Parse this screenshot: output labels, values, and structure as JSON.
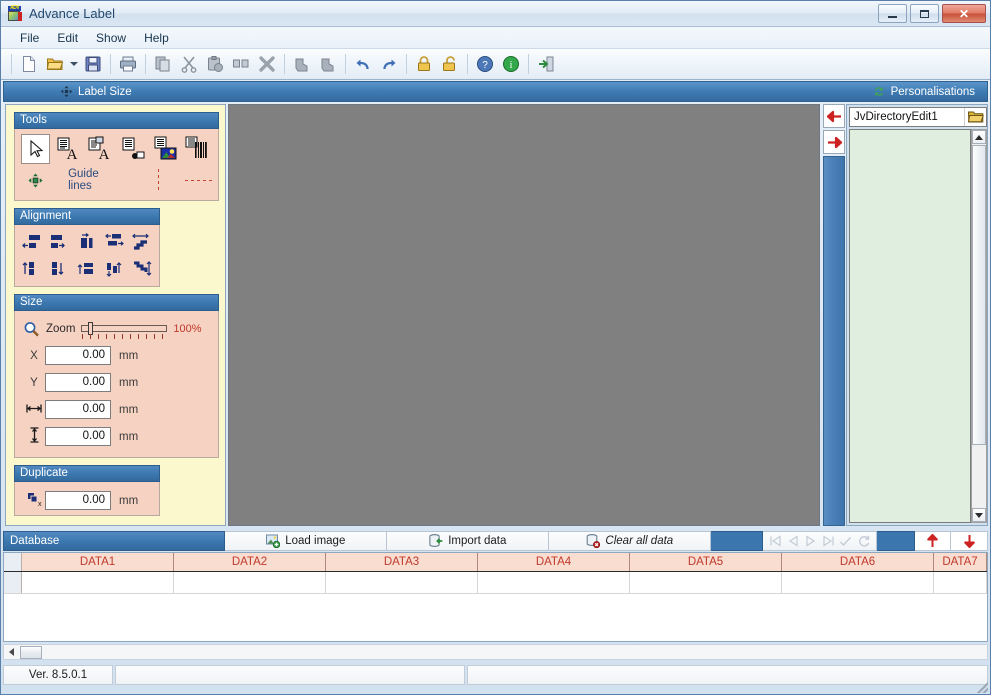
{
  "window": {
    "title": "Advance Label",
    "icon": "app-icon",
    "minimize_label": "–",
    "maximize_label": "□",
    "close_label": "✕"
  },
  "menubar": {
    "items": [
      {
        "label": "File",
        "name": "menu-file"
      },
      {
        "label": "Edit",
        "name": "menu-edit"
      },
      {
        "label": "Show",
        "name": "menu-show"
      },
      {
        "label": "Help",
        "name": "menu-help"
      }
    ]
  },
  "toolbar": {
    "buttons": [
      {
        "name": "new-document-button",
        "icon": "new-document-icon",
        "tooltip": "New"
      },
      {
        "name": "open-folder-button",
        "icon": "open-folder-icon",
        "tooltip": "Open"
      },
      {
        "name": "open-dropdown-button",
        "icon": "chevron-down-icon",
        "tooltip": "Recent"
      },
      {
        "name": "save-button",
        "icon": "save-disk-icon",
        "tooltip": "Save"
      },
      {
        "name": "print-button",
        "icon": "printer-icon",
        "tooltip": "Print"
      },
      {
        "name": "copy-button",
        "icon": "copy-icon",
        "tooltip": "Copy"
      },
      {
        "name": "cut-button",
        "icon": "scissors-icon",
        "tooltip": "Cut"
      },
      {
        "name": "paste-button",
        "icon": "paste-icon",
        "tooltip": "Paste"
      },
      {
        "name": "duplicate-button",
        "icon": "duplicate-icon",
        "tooltip": "Duplicate"
      },
      {
        "name": "delete-button",
        "icon": "delete-x-icon",
        "tooltip": "Delete"
      },
      {
        "name": "bring-front-button",
        "icon": "bring-front-icon",
        "tooltip": "Bring to front"
      },
      {
        "name": "send-back-button",
        "icon": "send-back-icon",
        "tooltip": "Send to back"
      },
      {
        "name": "undo-button",
        "icon": "undo-arrow-icon",
        "tooltip": "Undo"
      },
      {
        "name": "redo-button",
        "icon": "redo-arrow-icon",
        "tooltip": "Redo"
      },
      {
        "name": "lock-button",
        "icon": "lock-closed-icon",
        "tooltip": "Lock"
      },
      {
        "name": "unlock-button",
        "icon": "lock-open-icon",
        "tooltip": "Unlock"
      },
      {
        "name": "help-button",
        "icon": "help-question-icon",
        "tooltip": "Help"
      },
      {
        "name": "about-button",
        "icon": "info-icon",
        "tooltip": "About"
      },
      {
        "name": "exit-button",
        "icon": "exit-door-icon",
        "tooltip": "Exit"
      }
    ]
  },
  "header": {
    "label_size": "Label Size",
    "label_size_icon": "move-resize-icon",
    "personalisations": "Personalisations",
    "personalisations_icon": "refresh-arrows-icon"
  },
  "tools_panel": {
    "title": "Tools",
    "buttons": [
      {
        "name": "tool-select",
        "icon": "cursor-arrow-icon",
        "selected": true
      },
      {
        "name": "tool-text",
        "icon": "text-a-icon",
        "selected": false
      },
      {
        "name": "tool-rich-text",
        "icon": "rich-text-a-icon",
        "selected": false
      },
      {
        "name": "tool-shape",
        "icon": "shape-object-icon",
        "selected": false
      },
      {
        "name": "tool-image",
        "icon": "picture-image-icon",
        "selected": false
      },
      {
        "name": "tool-barcode",
        "icon": "barcode-icon",
        "selected": false
      }
    ],
    "guide_lines_icon": "move-cross-icon",
    "guide_lines_label": "Guide lines",
    "vertical_guide": "vertical-dashed-guide",
    "horizontal_guide": "horizontal-dashed-guide"
  },
  "alignment_panel": {
    "title": "Alignment",
    "buttons": [
      {
        "name": "align-left",
        "icon": "align-left-icon"
      },
      {
        "name": "align-right",
        "icon": "align-right-icon"
      },
      {
        "name": "align-center-horizontal",
        "icon": "align-center-h-icon"
      },
      {
        "name": "distribute-horizontal",
        "icon": "distribute-h-icon"
      },
      {
        "name": "equal-width",
        "icon": "equal-width-icon"
      },
      {
        "name": "align-top",
        "icon": "align-top-icon"
      },
      {
        "name": "align-bottom",
        "icon": "align-bottom-icon"
      },
      {
        "name": "align-center-vertical",
        "icon": "align-center-v-icon"
      },
      {
        "name": "distribute-vertical",
        "icon": "distribute-v-icon"
      },
      {
        "name": "equal-height",
        "icon": "equal-height-icon"
      }
    ]
  },
  "size_panel": {
    "title": "Size",
    "zoom_icon": "magnifier-icon",
    "zoom_label": "Zoom",
    "zoom_value": "100%",
    "fields": [
      {
        "name": "field-x",
        "label": "X",
        "icon": "",
        "value": "0.00",
        "unit": "mm"
      },
      {
        "name": "field-y",
        "label": "Y",
        "icon": "",
        "value": "0.00",
        "unit": "mm"
      },
      {
        "name": "field-width",
        "label": "",
        "icon": "width-arrows-icon",
        "value": "0.00",
        "unit": "mm"
      },
      {
        "name": "field-height",
        "label": "",
        "icon": "height-arrows-icon",
        "value": "0.00",
        "unit": "mm"
      }
    ]
  },
  "duplicate_panel": {
    "title": "Duplicate",
    "field": {
      "name": "field-duplicate-x",
      "icon": "duplicate-x-icon",
      "value": "0.00",
      "unit": "mm"
    }
  },
  "canvas": {
    "name": "label-design-canvas",
    "background": "#808080"
  },
  "splitter": {
    "left_arrow_icon": "arrow-left-red-icon",
    "right_arrow_icon": "arrow-right-red-icon"
  },
  "right_panel": {
    "directory_edit": {
      "name": "directory-edit-input",
      "value": "JvDirectoryEdit1",
      "browse_icon": "folder-open-icon"
    },
    "file_list": {
      "name": "file-list-box",
      "items": []
    },
    "scrollbar": {
      "up_icon": "scroll-up-icon",
      "down_icon": "scroll-down-icon"
    }
  },
  "database_bar": {
    "title": "Database",
    "buttons": [
      {
        "name": "load-image-button",
        "label": "Load image",
        "icon": "image-plus-icon",
        "italic": false
      },
      {
        "name": "import-data-button",
        "label": "Import data",
        "icon": "database-import-icon",
        "italic": false
      },
      {
        "name": "clear-all-data-button",
        "label": "Clear all data",
        "icon": "database-delete-icon",
        "italic": true
      }
    ],
    "nav_buttons": [
      {
        "name": "nav-first-record",
        "icon": "first-record-icon"
      },
      {
        "name": "nav-prev-record",
        "icon": "prev-record-icon"
      },
      {
        "name": "nav-next-record",
        "icon": "next-record-icon"
      },
      {
        "name": "nav-last-record",
        "icon": "last-record-icon"
      },
      {
        "name": "nav-post-record",
        "icon": "post-check-icon"
      },
      {
        "name": "nav-refresh-record",
        "icon": "refresh-record-icon"
      }
    ],
    "move_up": {
      "name": "move-row-up-button",
      "icon": "arrow-up-red-icon"
    },
    "move_down": {
      "name": "move-row-down-button",
      "icon": "arrow-down-red-icon"
    }
  },
  "grid": {
    "columns": [
      {
        "label": "DATA1",
        "width": 152
      },
      {
        "label": "DATA2",
        "width": 152
      },
      {
        "label": "DATA3",
        "width": 152
      },
      {
        "label": "DATA4",
        "width": 152
      },
      {
        "label": "DATA5",
        "width": 152
      },
      {
        "label": "DATA6",
        "width": 152
      },
      {
        "label": "DATA7",
        "width": 53
      }
    ],
    "rows": [
      {
        "cells": [
          "",
          "",
          "",
          "",
          "",
          "",
          ""
        ]
      }
    ]
  },
  "hscrollbar": {
    "name": "horizontal-scrollbar",
    "left_arrow_icon": "scroll-left-icon"
  },
  "statusbar": {
    "version": "Ver. 8.5.0.1",
    "middle": "",
    "right": ""
  },
  "colors": {
    "titlebar_text": "#24486f",
    "panel_background": "#fbf8cd",
    "group_body": "#f6d2c2",
    "group_header": "#3b77ae",
    "canvas": "#808080",
    "grid_header_bg": "#f8ddd0",
    "grid_header_text": "#c0392b",
    "list_background": "#dfeede",
    "accent_red": "#c0392b"
  }
}
